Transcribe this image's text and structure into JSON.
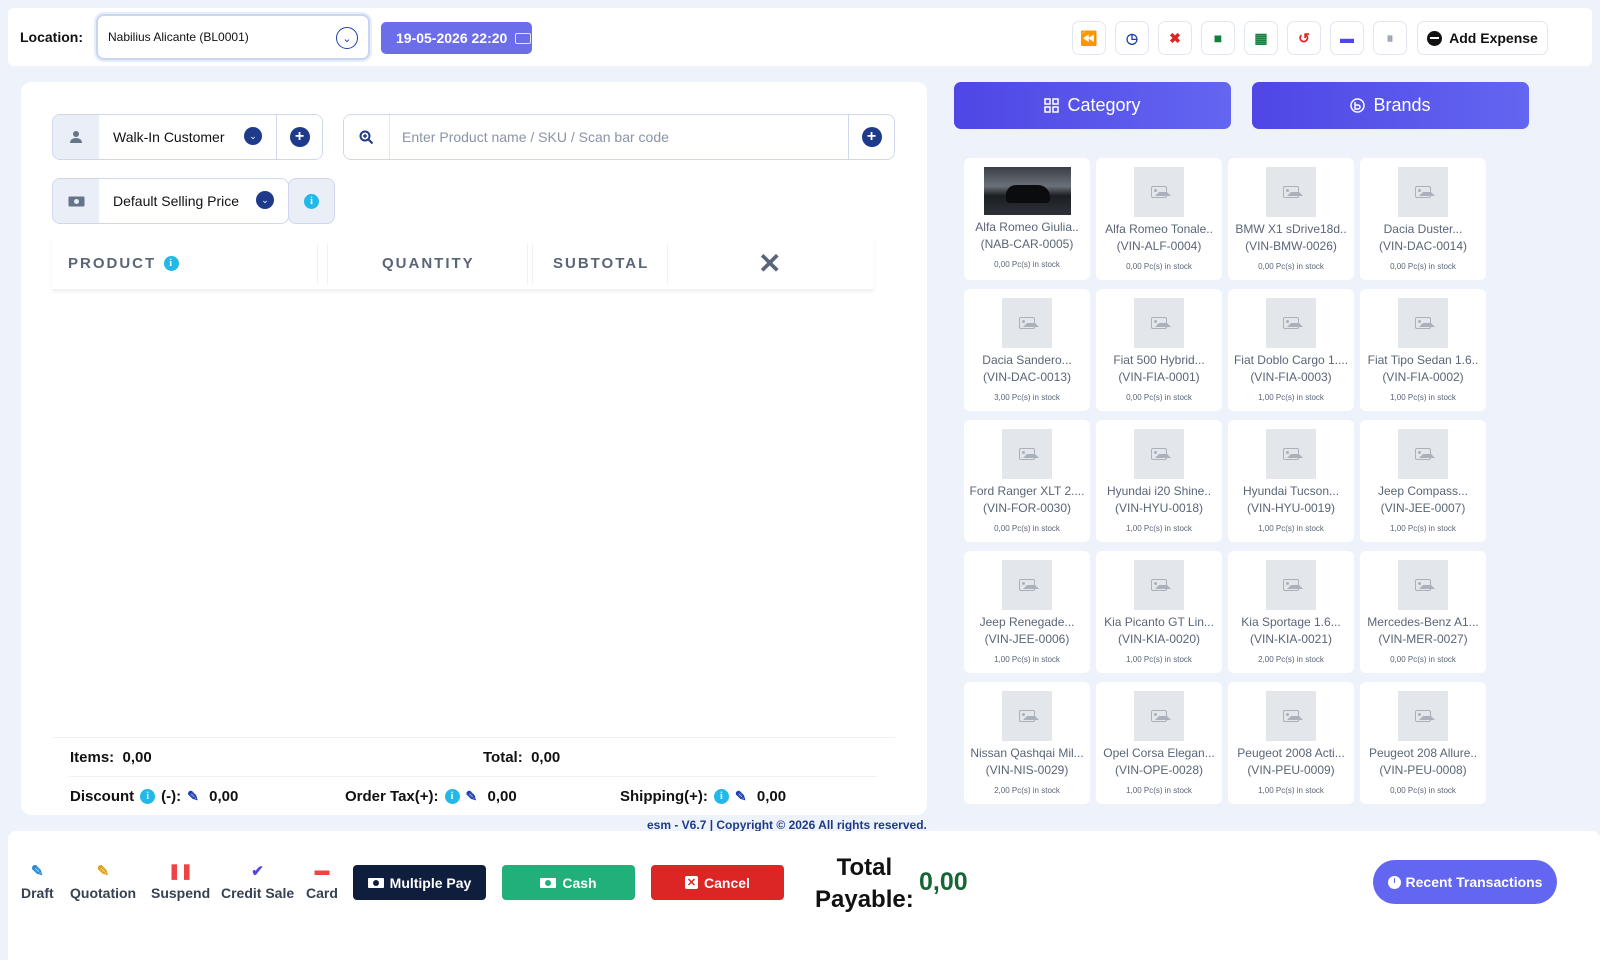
{
  "topbar": {
    "location_label": "Location:",
    "location_value": "Nabilius Alicante (BL0001)",
    "datetime": "19-05-2026 22:20",
    "tools": [
      {
        "icon": "rewind-icon",
        "glyph": "⏪",
        "color": "#2563eb"
      },
      {
        "icon": "clock-icon",
        "glyph": "◷",
        "color": "#1e40af"
      },
      {
        "icon": "close-register-icon",
        "glyph": "✖",
        "color": "#dc2626"
      },
      {
        "icon": "briefcase-icon",
        "glyph": "■",
        "color": "#15803d"
      },
      {
        "icon": "calculator-icon",
        "glyph": "▦",
        "color": "#15803d"
      },
      {
        "icon": "undo-icon",
        "glyph": "↺",
        "color": "#dc2626"
      },
      {
        "icon": "credit-card-icon",
        "glyph": "▬",
        "color": "#4f46e5"
      },
      {
        "icon": "pause-icon",
        "glyph": "⏸",
        "color": "#9ca3af"
      }
    ],
    "add_expense": "Add Expense"
  },
  "cart": {
    "customer": "Walk-In Customer",
    "search_placeholder": "Enter Product name / SKU / Scan bar code",
    "price_group": "Default Selling Price",
    "headers": {
      "product": "PRODUCT",
      "quantity": "QUANTITY",
      "subtotal": "SUBTOTAL",
      "remove": "✕"
    },
    "items_label": "Items:",
    "items_value": "0,00",
    "total_label": "Total:",
    "total_value": "0,00",
    "discount_label": "Discount",
    "discount_sign": "(-):",
    "discount_value": "0,00",
    "tax_label": "Order Tax(+):",
    "tax_value": "0,00",
    "shipping_label": "Shipping(+):",
    "shipping_value": "0,00"
  },
  "filters": {
    "category": "Category",
    "brands": "Brands"
  },
  "products": [
    {
      "name": "Alfa Romeo Giulia..",
      "sku": "(NAB-CAR-0005)",
      "stock": "0,00 Pc(s) in stock",
      "photo": true
    },
    {
      "name": "Alfa Romeo Tonale..",
      "sku": "(VIN-ALF-0004)",
      "stock": "0,00 Pc(s) in stock",
      "photo": false
    },
    {
      "name": "BMW X1 sDrive18d..",
      "sku": "(VIN-BMW-0026)",
      "stock": "0,00 Pc(s) in stock",
      "photo": false
    },
    {
      "name": "Dacia Duster...",
      "sku": "(VIN-DAC-0014)",
      "stock": "0,00 Pc(s) in stock",
      "photo": false
    },
    {
      "name": "Dacia Sandero...",
      "sku": "(VIN-DAC-0013)",
      "stock": "3,00 Pc(s) in stock",
      "photo": false
    },
    {
      "name": "Fiat 500 Hybrid...",
      "sku": "(VIN-FIA-0001)",
      "stock": "0,00 Pc(s) in stock",
      "photo": false
    },
    {
      "name": "Fiat Doblo Cargo 1....",
      "sku": "(VIN-FIA-0003)",
      "stock": "1,00 Pc(s) in stock",
      "photo": false
    },
    {
      "name": "Fiat Tipo Sedan 1.6..",
      "sku": "(VIN-FIA-0002)",
      "stock": "1,00 Pc(s) in stock",
      "photo": false
    },
    {
      "name": "Ford Ranger XLT 2....",
      "sku": "(VIN-FOR-0030)",
      "stock": "0,00 Pc(s) in stock",
      "photo": false
    },
    {
      "name": "Hyundai i20 Shine..",
      "sku": "(VIN-HYU-0018)",
      "stock": "1,00 Pc(s) in stock",
      "photo": false
    },
    {
      "name": "Hyundai Tucson...",
      "sku": "(VIN-HYU-0019)",
      "stock": "1,00 Pc(s) in stock",
      "photo": false
    },
    {
      "name": "Jeep Compass...",
      "sku": "(VIN-JEE-0007)",
      "stock": "1,00 Pc(s) in stock",
      "photo": false
    },
    {
      "name": "Jeep Renegade...",
      "sku": "(VIN-JEE-0006)",
      "stock": "1,00 Pc(s) in stock",
      "photo": false
    },
    {
      "name": "Kia Picanto GT Lin...",
      "sku": "(VIN-KIA-0020)",
      "stock": "1,00 Pc(s) in stock",
      "photo": false
    },
    {
      "name": "Kia Sportage 1.6...",
      "sku": "(VIN-KIA-0021)",
      "stock": "2,00 Pc(s) in stock",
      "photo": false
    },
    {
      "name": "Mercedes-Benz A1...",
      "sku": "(VIN-MER-0027)",
      "stock": "0,00 Pc(s) in stock",
      "photo": false
    },
    {
      "name": "Nissan Qashqai Mil...",
      "sku": "(VIN-NIS-0029)",
      "stock": "2,00 Pc(s) in stock",
      "photo": false
    },
    {
      "name": "Opel Corsa Elegan...",
      "sku": "(VIN-OPE-0028)",
      "stock": "1,00 Pc(s) in stock",
      "photo": false
    },
    {
      "name": "Peugeot 2008 Acti...",
      "sku": "(VIN-PEU-0009)",
      "stock": "1,00 Pc(s) in stock",
      "photo": false
    },
    {
      "name": "Peugeot 208 Allure..",
      "sku": "(VIN-PEU-0008)",
      "stock": "0,00 Pc(s) in stock",
      "photo": false
    }
  ],
  "footer": {
    "copyright": "esm - V6.7 | Copyright © 2026 All rights reserved.",
    "draft": "Draft",
    "quotation": "Quotation",
    "suspend": "Suspend",
    "credit_sale": "Credit Sale",
    "card": "Card",
    "multiple_pay": "Multiple Pay",
    "cash": "Cash",
    "cancel": "Cancel",
    "total_payable_line1": "Total",
    "total_payable_line2": "Payable:",
    "total_payable_value": "0,00",
    "recent_transactions": "Recent Transactions"
  }
}
